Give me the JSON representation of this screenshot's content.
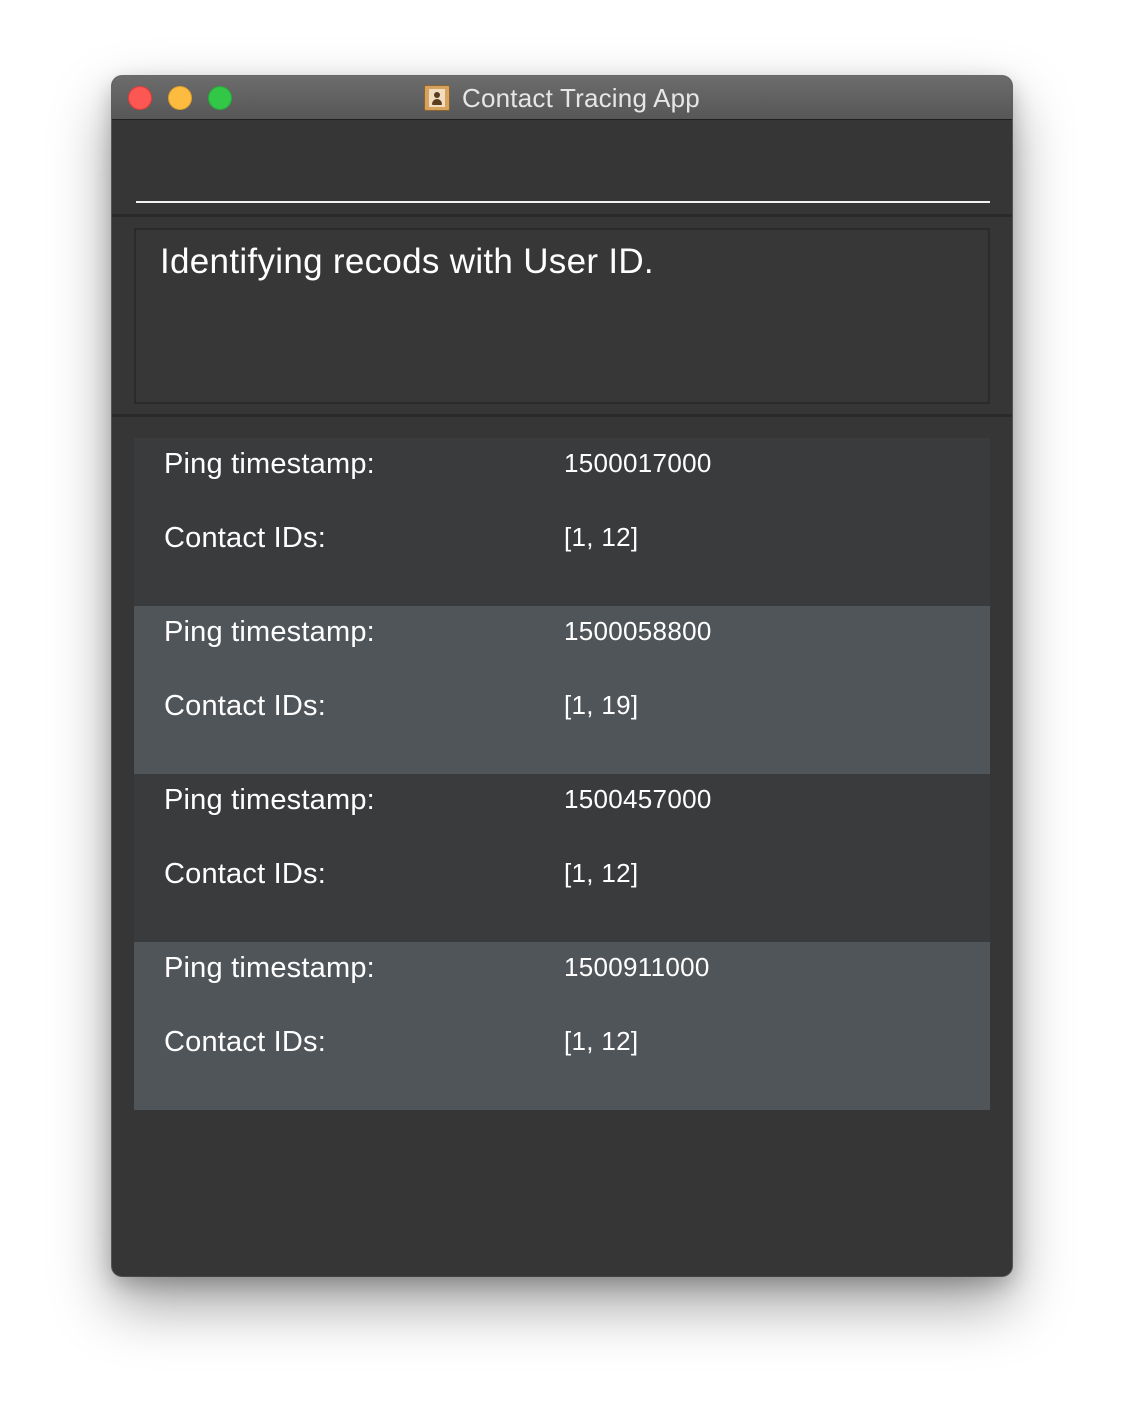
{
  "window": {
    "title": "Contact Tracing App",
    "app_icon": "contacts-book-icon"
  },
  "input": {
    "value": "",
    "placeholder": ""
  },
  "message": "Identifying recods with User ID.",
  "records": [
    {
      "timestamp_label": "Ping timestamp:",
      "timestamp": "1500017000",
      "contacts_label": "Contact IDs:",
      "contacts": "[1, 12]"
    },
    {
      "timestamp_label": "Ping timestamp:",
      "timestamp": "1500058800",
      "contacts_label": "Contact IDs:",
      "contacts": "[1, 19]"
    },
    {
      "timestamp_label": "Ping timestamp:",
      "timestamp": "1500457000",
      "contacts_label": "Contact IDs:",
      "contacts": "[1, 12]"
    },
    {
      "timestamp_label": "Ping timestamp:",
      "timestamp": "1500911000",
      "contacts_label": "Contact IDs:",
      "contacts": "[1, 12]"
    }
  ],
  "colors": {
    "window_bg": "#363636",
    "row_odd": "#3a3b3d",
    "row_even": "#50555a",
    "close": "#fc5753",
    "minimize": "#fdbc40",
    "zoom": "#33c748"
  }
}
